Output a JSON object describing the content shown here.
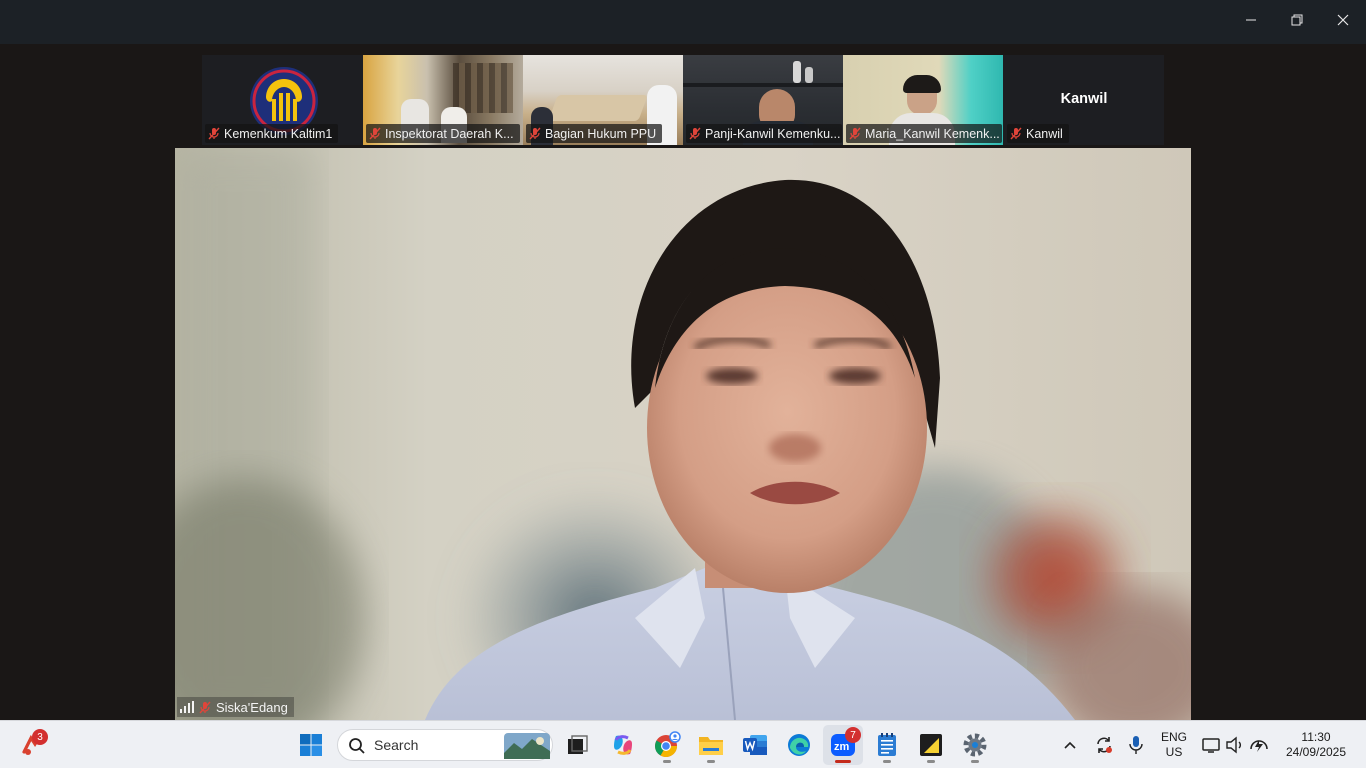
{
  "window": {
    "controls": {
      "minimize_icon": "minimize-icon",
      "maximize_icon": "restore-icon",
      "close_icon": "close-icon"
    }
  },
  "thumbnails": [
    {
      "name": "Kemenkum Kaltim1",
      "muted": true,
      "type": "logo"
    },
    {
      "name": "Inspektorat Daerah K...",
      "muted": true,
      "type": "video"
    },
    {
      "name": "Bagian Hukum PPU",
      "muted": true,
      "type": "video"
    },
    {
      "name": "Panji-Kanwil Kemenku...",
      "muted": true,
      "type": "video"
    },
    {
      "name": "Maria_Kanwil Kemenk...",
      "muted": true,
      "type": "video"
    },
    {
      "name": "Kanwil",
      "muted": true,
      "type": "name-only",
      "display_name": "Kanwil"
    }
  ],
  "main_speaker": {
    "name": "Siska'Edang",
    "muted": true,
    "signal_icon": "signal-bars-icon"
  },
  "taskbar": {
    "notification_badge": "3",
    "search_placeholder": "Search",
    "zoom_badge": "7",
    "apps": [
      "start-icon",
      "task-view-icon",
      "copilot-icon",
      "chrome-icon",
      "file-explorer-icon",
      "word-icon",
      "edge-icon",
      "zoom-icon",
      "notepad-icon",
      "sticky-notes-icon",
      "settings-icon"
    ],
    "tray": {
      "language_top": "ENG",
      "language_bottom": "US",
      "time": "11:30",
      "date": "24/09/2025"
    }
  },
  "colors": {
    "accent": "#0f6cbd",
    "badge": "#d32f2f",
    "mic_off": "#e0453a",
    "taskbar": "#eef0f4"
  }
}
